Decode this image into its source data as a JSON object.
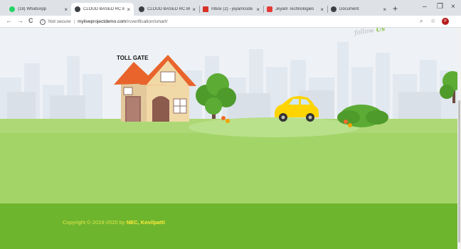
{
  "browser": {
    "tabs": [
      {
        "label": "(18) WhatsApp",
        "favicon": "whatsapp-icon",
        "color": "#25d366",
        "active": false
      },
      {
        "label": "CLOUD BASED RC BO",
        "favicon": "globe-icon",
        "color": "#3c4043",
        "active": true
      },
      {
        "label": "CLOUD BASED RC BO",
        "favicon": "globe-icon",
        "color": "#3c4043",
        "active": false
      },
      {
        "label": "Inbox (2) - jeyamcode",
        "favicon": "gmail-icon",
        "color": "#d93025",
        "active": false
      },
      {
        "label": "Jeyam Technologies",
        "favicon": "jeyam-icon",
        "color": "#e53935",
        "active": false
      },
      {
        "label": "Document",
        "favicon": "globe-icon",
        "color": "#3c4043",
        "active": false
      }
    ],
    "tab_close_glyph": "×",
    "new_tab_glyph": "+",
    "window_controls": {
      "minimize": "–",
      "maximize": "❐",
      "close": "×"
    },
    "nav": {
      "back": "←",
      "forward": "→",
      "reload": "C"
    },
    "address": {
      "security_label": "Not secure",
      "separator": "|",
      "domain": "myliveprojectdemo.com",
      "path": "/rcverification/smart/"
    },
    "profile_initial": "P"
  },
  "page": {
    "building_label": "TOLL GATE",
    "follow_label": "follow",
    "follow_emphasis": "Us",
    "footer": {
      "copyright_text": "Copyright © 2019-2020 by ",
      "brand": "NEC, Kovilpatti"
    }
  },
  "colors": {
    "sky": "#eef2f6",
    "grass": "#a3d468",
    "footer": "#6eb52e",
    "roof": "#e8642c",
    "house_wall": "#f1d9a7",
    "car": "#ffd400",
    "tree": "#55a630",
    "copyright_text": "#dfe84a",
    "brand_text": "#ffeb3b"
  }
}
